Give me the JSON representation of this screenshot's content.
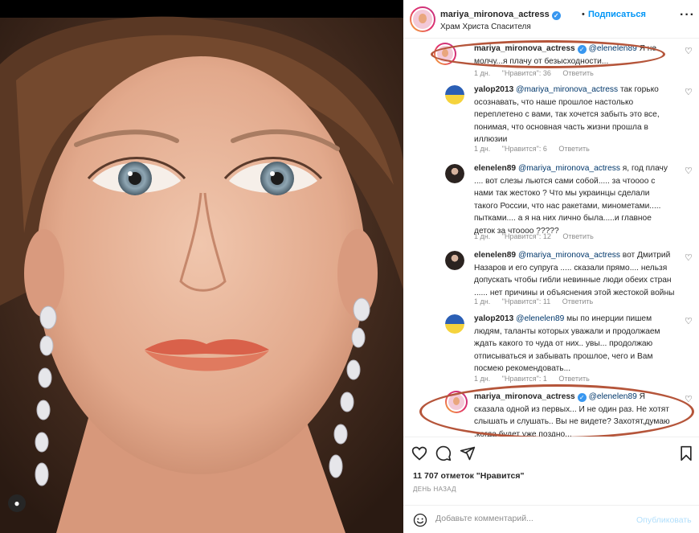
{
  "post": {
    "username": "mariya_mironova_actress",
    "follow_label": "Подписаться",
    "separator": "•",
    "location": "Храм Христа Спасителя",
    "more_icon": "more-horizontal-icon"
  },
  "comments": [
    {
      "user": "mariya_mironova_actress",
      "verified": true,
      "mention": "@elenelen89",
      "text": " Я не молчу...я плачу от безысходности...",
      "time": "1 дн.",
      "likes": "\"Нравится\": 36",
      "reply": "Ответить"
    },
    {
      "user": "yalop2013",
      "mention": "@mariya_mironova_actress",
      "text": " так горько осознавать, что наше прошлое настолько переплетено с вами, так хочется забыть это все, понимая, что основная часть жизни прошла в иллюзии",
      "time": "1 дн.",
      "likes": "\"Нравится\": 6",
      "reply": "Ответить"
    },
    {
      "user": "elenelen89",
      "mention": "@mariya_mironova_actress",
      "text": " я, год плачу .... вот слезы льются сами собой..... за чтоооо с нами так жестоко ? Что мы украинцы сделали такого России, что нас ракетами, минометами..... пытками.... а я на них лично была.....и главное деток за чтоооо ?????",
      "time": "1 дн.",
      "likes": "\"Нравится\": 12",
      "reply": "Ответить"
    },
    {
      "user": "elenelen89",
      "mention": "@mariya_mironova_actress",
      "text": " вот Дмитрий Назаров и его супруга ..... сказали прямо.... нельзя допускать чтобы гибли невинные люди обеих стран ...... нет причины и объяснения этой жестокой войны",
      "time": "1 дн.",
      "likes": "\"Нравится\": 11",
      "reply": "Ответить"
    },
    {
      "user": "yalop2013",
      "mention": "@elenelen89",
      "text": " мы по инерции пишем людям, таланты которых уважали и продолжаем ждать какого то чуда от них.. увы... продолжаю отписываться и забывать прошлое, чего и Вам посмею рекомендовать...",
      "time": "1 дн.",
      "likes": "\"Нравится\": 1",
      "reply": "Ответить"
    },
    {
      "user": "mariya_mironova_actress",
      "verified": true,
      "mention": "@elenelen89",
      "text": " Я сказала одной из первых... И не один раз. Не хотят слышать и слушать.. Вы не видете? Захотят,думаю ,когда будет уже поздно...",
      "time": "",
      "likes": "",
      "reply": ""
    }
  ],
  "actions": {
    "icons": [
      "heart-icon",
      "comment-icon",
      "share-icon",
      "bookmark-icon"
    ],
    "likes_text": "11 707 отметок \"Нравится\"",
    "date_text": "ДЕНЬ НАЗАД"
  },
  "add_comment": {
    "placeholder": "Добавьте комментарий...",
    "publish_label": "Опубликовать"
  },
  "colors": {
    "accent": "#0095f6",
    "annotation_oval": "#b5553a",
    "muted": "#8e8e8e"
  }
}
